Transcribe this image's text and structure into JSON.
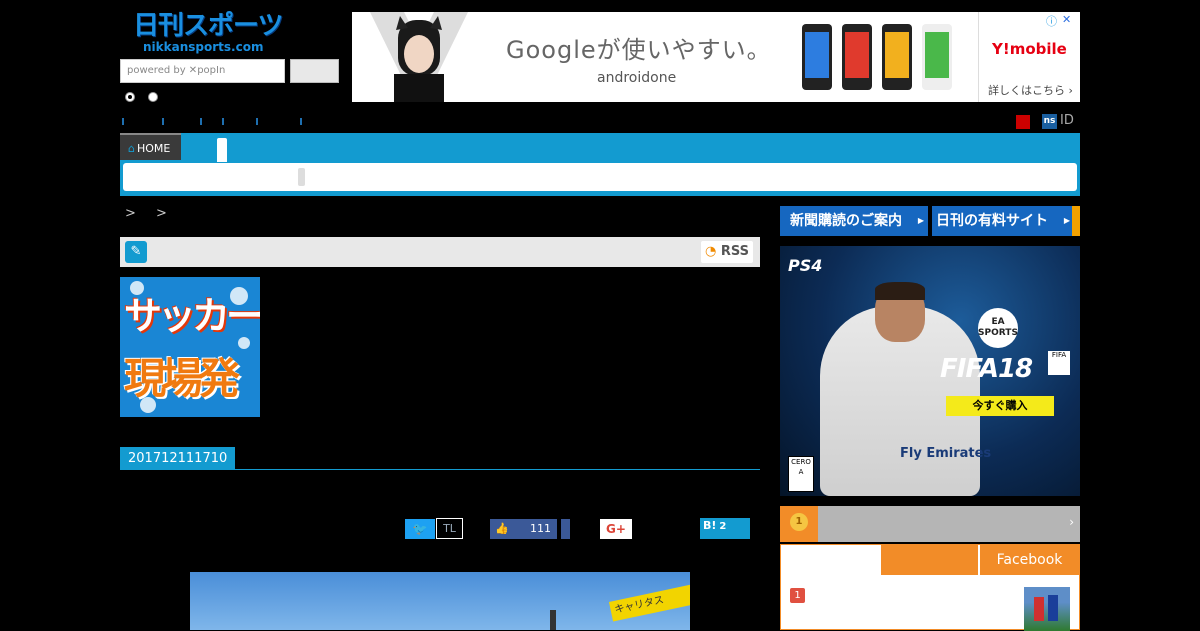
{
  "header": {
    "logo_ja": "日刊スポーツ",
    "logo_url": "nikkansports.com",
    "search_placeholder": "powered by ✕popIn",
    "search_button": ""
  },
  "ad": {
    "headline": "Googleが使いやすい。",
    "subbrand": "androidone",
    "brand": "Y!mobile",
    "more": "詳しくはこちら ›",
    "info_icon": "info-icon",
    "close_icon": "close-icon"
  },
  "topbar": {
    "ns_badge": "ns",
    "id_label": "ID"
  },
  "nav": {
    "home_label": "HOME"
  },
  "breadcrumb": "> >",
  "category": {
    "rss_label": "RSS"
  },
  "column_image": {
    "line1": "サッカー",
    "line2": "現場発"
  },
  "article": {
    "date_id": "201712111710"
  },
  "social": {
    "twitter_icon": "twitter-bird-icon",
    "tl_label": "TL",
    "fb_count": "111",
    "gplus_label": "G+",
    "hatena_label": "B!",
    "hatena_count": "2"
  },
  "photo": {
    "sign_text": "キャリタス"
  },
  "sidebar": {
    "subscribe_label": "新聞購読のご案内",
    "paid_label": "日刊の有料サイト",
    "game_ad": {
      "platform": "PS4",
      "badge": "EA SPORTS",
      "title": "FIFA18",
      "buy": "今すぐ購入",
      "jersey": "Fly Emirates",
      "rating": "CERO A"
    },
    "ranking": {
      "arrow": "›",
      "tab_facebook": "Facebook",
      "first_rank": "1",
      "medal": "1"
    }
  },
  "colors": {
    "accent_blue": "#139bd0",
    "facebook": "#3b5998",
    "twitter": "#1da1f2",
    "ranking_orange": "#f28c28"
  }
}
